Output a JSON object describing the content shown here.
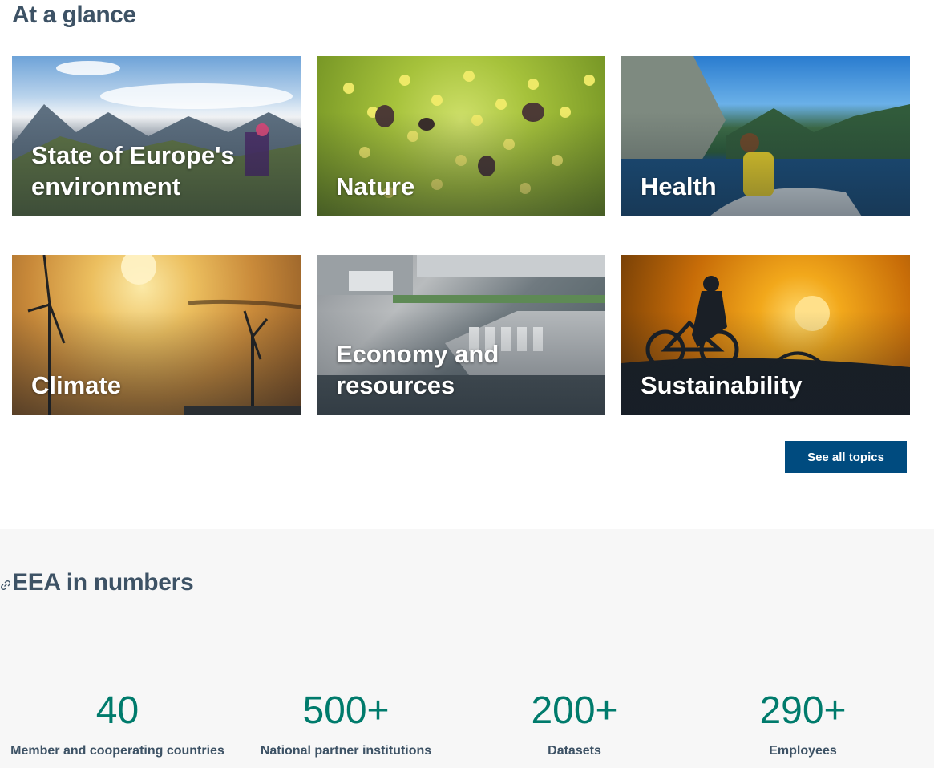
{
  "at_a_glance": {
    "title": "At a glance",
    "cards": [
      {
        "label": "State of Europe's environment",
        "image": "mountain-hikers"
      },
      {
        "label": "Nature",
        "image": "flower-insects"
      },
      {
        "label": "Health",
        "image": "lake-person-boat"
      },
      {
        "label": "Climate",
        "image": "wind-turbines-sunset"
      },
      {
        "label": "Economy and resources",
        "image": "aerial-warehouse"
      },
      {
        "label": "Sustainability",
        "image": "cyclist-silhouette-sun"
      }
    ],
    "see_all_label": "See all topics"
  },
  "numbers": {
    "title": "EEA in numbers",
    "link_icon": "link-icon",
    "stats": [
      {
        "value": "40",
        "caption": "Member and cooperating countries"
      },
      {
        "value": "500+",
        "caption": "National partner institutions"
      },
      {
        "value": "200+",
        "caption": "Datasets"
      },
      {
        "value": "290+",
        "caption": "Employees"
      }
    ]
  },
  "colors": {
    "heading": "#3d5265",
    "button": "#004b7f",
    "stat_value": "#007b6c",
    "numbers_bg": "#f7f7f7"
  }
}
